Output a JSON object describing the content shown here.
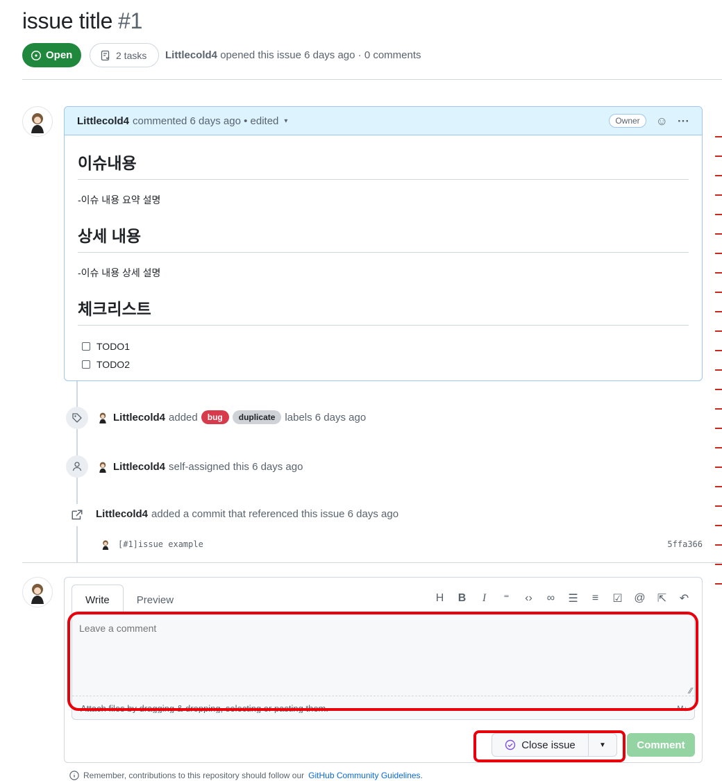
{
  "issue": {
    "title": "issue title",
    "number": "#1",
    "state": "Open",
    "tasks": "2 tasks",
    "author": "Littlecold4",
    "meta_suffix": "opened this issue 6 days ago · 0 comments"
  },
  "comment": {
    "author": "Littlecold4",
    "meta": "commented 6 days ago • edited",
    "badge": "Owner",
    "sections": [
      {
        "heading": "이슈내용",
        "text": "-이슈 내용 요약 설명"
      },
      {
        "heading": "상세 내용",
        "text": "-이슈 내용 상세 설명"
      },
      {
        "heading": "체크리스트"
      }
    ],
    "tasks": [
      "TODO1",
      "TODO2"
    ]
  },
  "timeline": {
    "labels_event": {
      "actor": "Littlecold4",
      "verb": "added",
      "labels": [
        "bug",
        "duplicate"
      ],
      "suffix": "labels 6 days ago",
      "bug_color": "#d73a4a",
      "duplicate_color": "#cfd3d7"
    },
    "assign_event": {
      "actor": "Littlecold4",
      "text": "self-assigned this 6 days ago"
    },
    "commit_event": {
      "actor": "Littlecold4",
      "text": "added a commit that referenced this issue 6 days ago",
      "commit_message": "[#1]issue example",
      "sha": "5ffa366"
    }
  },
  "editor": {
    "tabs": [
      "Write",
      "Preview"
    ],
    "placeholder": "Leave a comment",
    "attach_hint": "Attach files by dragging & dropping, selecting or pasting them.",
    "close_label": "Close issue",
    "comment_label": "Comment",
    "toolbar_icons": [
      "heading-icon",
      "bold-icon",
      "italic-icon",
      "quote-icon",
      "code-icon",
      "link-icon",
      "bullet-list-icon",
      "numbered-list-icon",
      "task-list-icon",
      "mention-icon",
      "reference-icon",
      "undo-icon"
    ]
  },
  "footer": {
    "note": "Remember, contributions to this repository should follow our",
    "link": "GitHub Community Guidelines",
    "end": "."
  },
  "colors": {
    "open_green": "#1f883d",
    "accent_blue": "#0969da",
    "annotation_red": "#e8000b"
  }
}
